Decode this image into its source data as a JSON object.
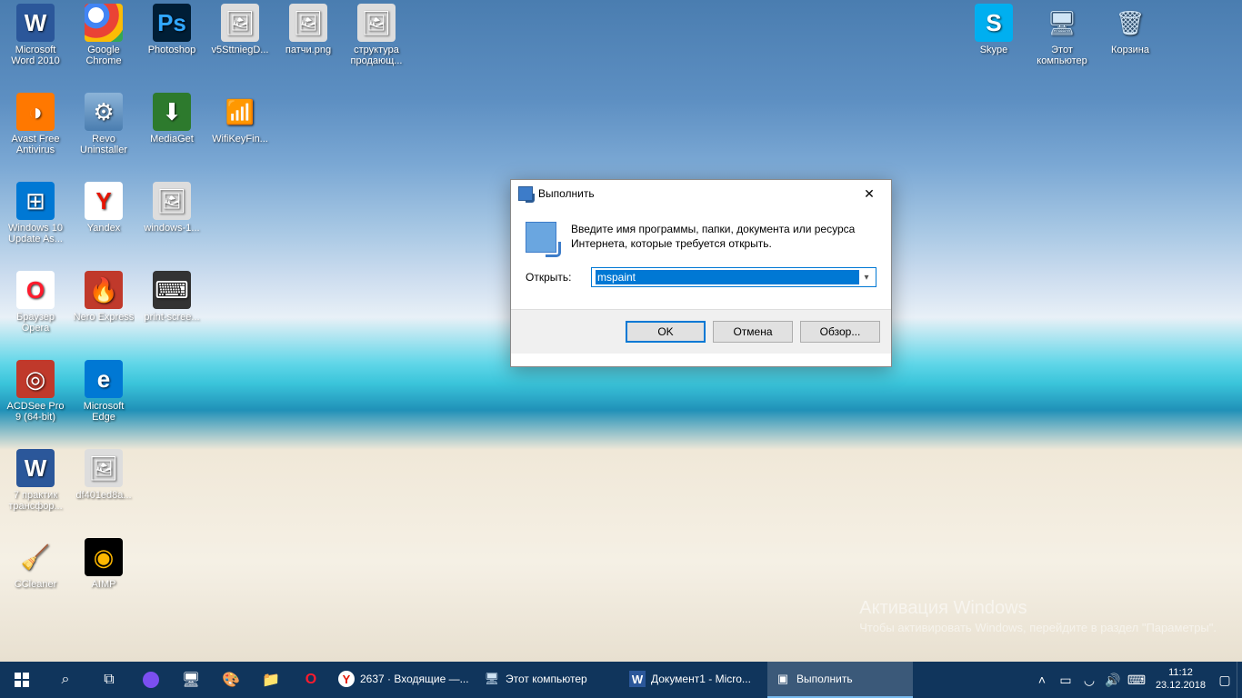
{
  "desktop": {
    "icons_left": [
      {
        "label": "Microsoft Word 2010",
        "cls": "ico-word",
        "glyph": "W",
        "name": "app-msword"
      },
      {
        "label": "Google Chrome",
        "cls": "ico-chrome",
        "glyph": "",
        "name": "app-chrome"
      },
      {
        "label": "Photoshop",
        "cls": "ico-ps",
        "glyph": "Ps",
        "name": "app-photoshop"
      },
      {
        "label": "v5SttniegD...",
        "cls": "ico-img",
        "glyph": "🖼",
        "name": "file-v5sttnieg"
      },
      {
        "label": "патчи.png",
        "cls": "ico-img",
        "glyph": "🖼",
        "name": "file-patchi-png"
      },
      {
        "label": "структура продающ...",
        "cls": "ico-img",
        "glyph": "🖼",
        "name": "file-struktura"
      },
      {
        "label": "Avast Free Antivirus",
        "cls": "ico-avast",
        "glyph": "◑",
        "name": "app-avast"
      },
      {
        "label": "Revo Uninstaller",
        "cls": "ico-revo",
        "glyph": "⚙",
        "name": "app-revo"
      },
      {
        "label": "MediaGet",
        "cls": "ico-media",
        "glyph": "⬇",
        "name": "app-mediaget"
      },
      {
        "label": "WifiKeyFin...",
        "cls": "ico-wifi",
        "glyph": "📶",
        "name": "app-wifikeyfinder"
      },
      {
        "label": "Windows 10 Update As...",
        "cls": "ico-w10",
        "glyph": "⊞",
        "name": "app-w10update"
      },
      {
        "label": "Yandex",
        "cls": "ico-yandex",
        "glyph": "Y",
        "name": "app-yandex"
      },
      {
        "label": "windows-1...",
        "cls": "ico-img",
        "glyph": "🖼",
        "name": "file-windows-1"
      },
      {
        "label": "Браузер Opera",
        "cls": "ico-opera",
        "glyph": "O",
        "name": "app-opera"
      },
      {
        "label": "Nero Express",
        "cls": "ico-nero",
        "glyph": "🔥",
        "name": "app-nero"
      },
      {
        "label": "print-scree...",
        "cls": "ico-kb",
        "glyph": "⌨",
        "name": "file-printscreen"
      },
      {
        "label": "ACDSee Pro 9 (64-bit)",
        "cls": "ico-acd",
        "glyph": "◎",
        "name": "app-acdsee"
      },
      {
        "label": "Microsoft Edge",
        "cls": "ico-edge",
        "glyph": "e",
        "name": "app-edge"
      },
      {
        "label": "7 практик трансфор...",
        "cls": "ico-word",
        "glyph": "W",
        "name": "file-7praktik"
      },
      {
        "label": "df401ed8a...",
        "cls": "ico-img",
        "glyph": "🖼",
        "name": "file-df401ed8a"
      },
      {
        "label": "CCleaner",
        "cls": "ico-cc",
        "glyph": "🧹",
        "name": "app-ccleaner"
      },
      {
        "label": "AIMP",
        "cls": "ico-aimp",
        "glyph": "◉",
        "name": "app-aimp"
      }
    ],
    "icons_right": [
      {
        "label": "Skype",
        "cls": "ico-skype",
        "glyph": "S",
        "name": "app-skype"
      },
      {
        "label": "Этот компьютер",
        "cls": "ico-pc",
        "glyph": "🖥",
        "name": "this-pc"
      },
      {
        "label": "Корзина",
        "cls": "ico-trash",
        "glyph": "🗑",
        "name": "recycle-bin"
      }
    ],
    "activation": {
      "title": "Активация Windows",
      "sub": "Чтобы активировать Windows, перейдите в раздел \"Параметры\"."
    }
  },
  "run_dialog": {
    "title": "Выполнить",
    "description": "Введите имя программы, папки, документа или ресурса Интернета, которые требуется открыть.",
    "open_label": "Открыть:",
    "value": "mspaint",
    "buttons": {
      "ok": "OK",
      "cancel": "Отмена",
      "browse": "Обзор..."
    }
  },
  "taskbar": {
    "tasks": [
      {
        "label": "2637 · Входящие —...",
        "cls": "ico-yandex",
        "glyph": "Y",
        "name": "task-yandex-mail",
        "active": false
      },
      {
        "label": "Этот компьютер",
        "cls": "ico-pc",
        "glyph": "🖥",
        "name": "task-this-pc",
        "active": false
      },
      {
        "label": "Документ1 - Micro...",
        "cls": "ico-word",
        "glyph": "W",
        "name": "task-word-doc1",
        "active": false
      },
      {
        "label": "Выполнить",
        "cls": "",
        "glyph": "▣",
        "name": "task-run-dialog",
        "active": true
      }
    ],
    "clock": {
      "time": "11:12",
      "date": "23.12.2018"
    }
  }
}
